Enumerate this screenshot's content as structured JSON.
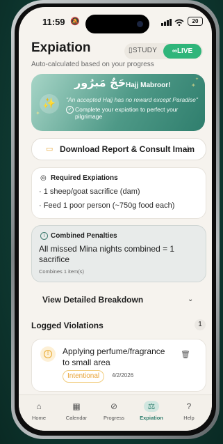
{
  "status": {
    "time": "11:59",
    "battery": "20"
  },
  "header": {
    "title": "Expiation",
    "subtitle": "Auto-calculated based on your progress"
  },
  "mode_toggle": {
    "study_label": "STUDY",
    "live_label": "LIVE",
    "selected": "LIVE"
  },
  "banner": {
    "arabic": "حَجٌ مَبرُور",
    "heading": "Hajj Mabroor!",
    "quote": "\"An accepted Hajj has no reward except Paradise\"",
    "note": "Complete your expiation to perfect your pilgrimage"
  },
  "download": {
    "label": "Download Report & Consult Imam"
  },
  "required": {
    "heading": "Required Expiations",
    "items": [
      "1 sheep/goat sacrifice (dam)",
      "Feed 1 poor person (~750g food each)"
    ]
  },
  "combined": {
    "heading": "Combined Penalties",
    "text": "All missed Mina nights combined = 1 sacrifice",
    "sub": "Combines 1 item(s)"
  },
  "breakdown": {
    "label": "View Detailed Breakdown"
  },
  "logged": {
    "heading": "Logged Violations",
    "count": "1"
  },
  "violation": {
    "title": "Applying perfume/fragrance to small area",
    "tag": "Intentional",
    "date": "4/2/2026"
  },
  "tabs": [
    {
      "label": "Home",
      "icon": "home-icon"
    },
    {
      "label": "Calendar",
      "icon": "calendar-icon"
    },
    {
      "label": "Progress",
      "icon": "progress-check-icon"
    },
    {
      "label": "Expiation",
      "icon": "scales-icon"
    },
    {
      "label": "Help",
      "icon": "help-icon"
    }
  ],
  "colors": {
    "accent": "#2fb57a",
    "teal": "#2f7e6d",
    "amber": "#e9a92e"
  }
}
